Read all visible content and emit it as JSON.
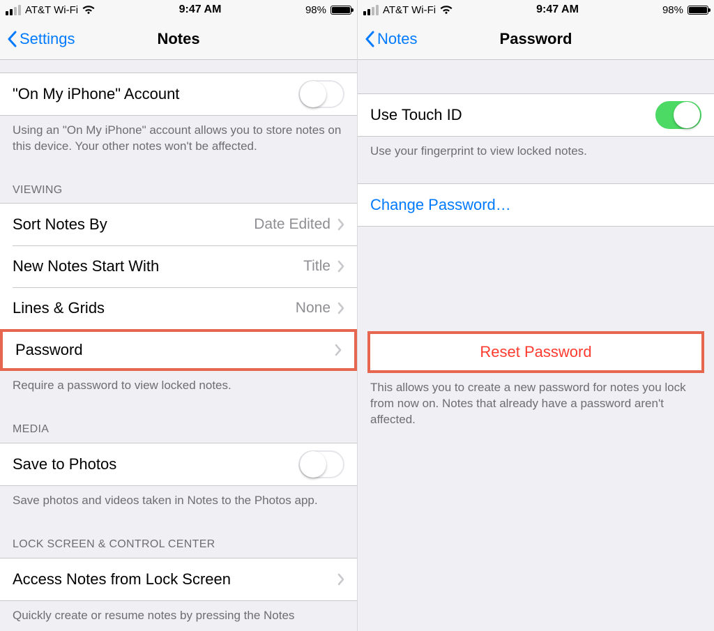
{
  "status": {
    "carrier": "AT&T Wi-Fi",
    "time": "9:47 AM",
    "battery_pct": "98%"
  },
  "left": {
    "back": "Settings",
    "title": "Notes",
    "on_my_iphone": {
      "label": "\"On My iPhone\" Account",
      "toggle": "off",
      "footer": "Using an \"On My iPhone\" account allows you to store notes on this device. Your other notes won't be affected."
    },
    "viewing_header": "VIEWING",
    "sort": {
      "label": "Sort Notes By",
      "value": "Date Edited"
    },
    "start_with": {
      "label": "New Notes Start With",
      "value": "Title"
    },
    "lines": {
      "label": "Lines & Grids",
      "value": "None"
    },
    "password": {
      "label": "Password",
      "footer": "Require a password to view locked notes."
    },
    "media_header": "MEDIA",
    "save_photos": {
      "label": "Save to Photos",
      "toggle": "off",
      "footer": "Save photos and videos taken in Notes to the Photos app."
    },
    "lock_header": "LOCK SCREEN & CONTROL CENTER",
    "access_lock": {
      "label": "Access Notes from Lock Screen",
      "footer": "Quickly create or resume notes by pressing the Notes"
    }
  },
  "right": {
    "back": "Notes",
    "title": "Password",
    "touch_id": {
      "label": "Use Touch ID",
      "toggle": "on",
      "footer": "Use your fingerprint to view locked notes."
    },
    "change_pw": {
      "label": "Change Password…"
    },
    "reset_pw": {
      "label": "Reset Password",
      "footer": "This allows you to create a new password for notes you lock from now on. Notes that already have a password aren't affected."
    }
  }
}
